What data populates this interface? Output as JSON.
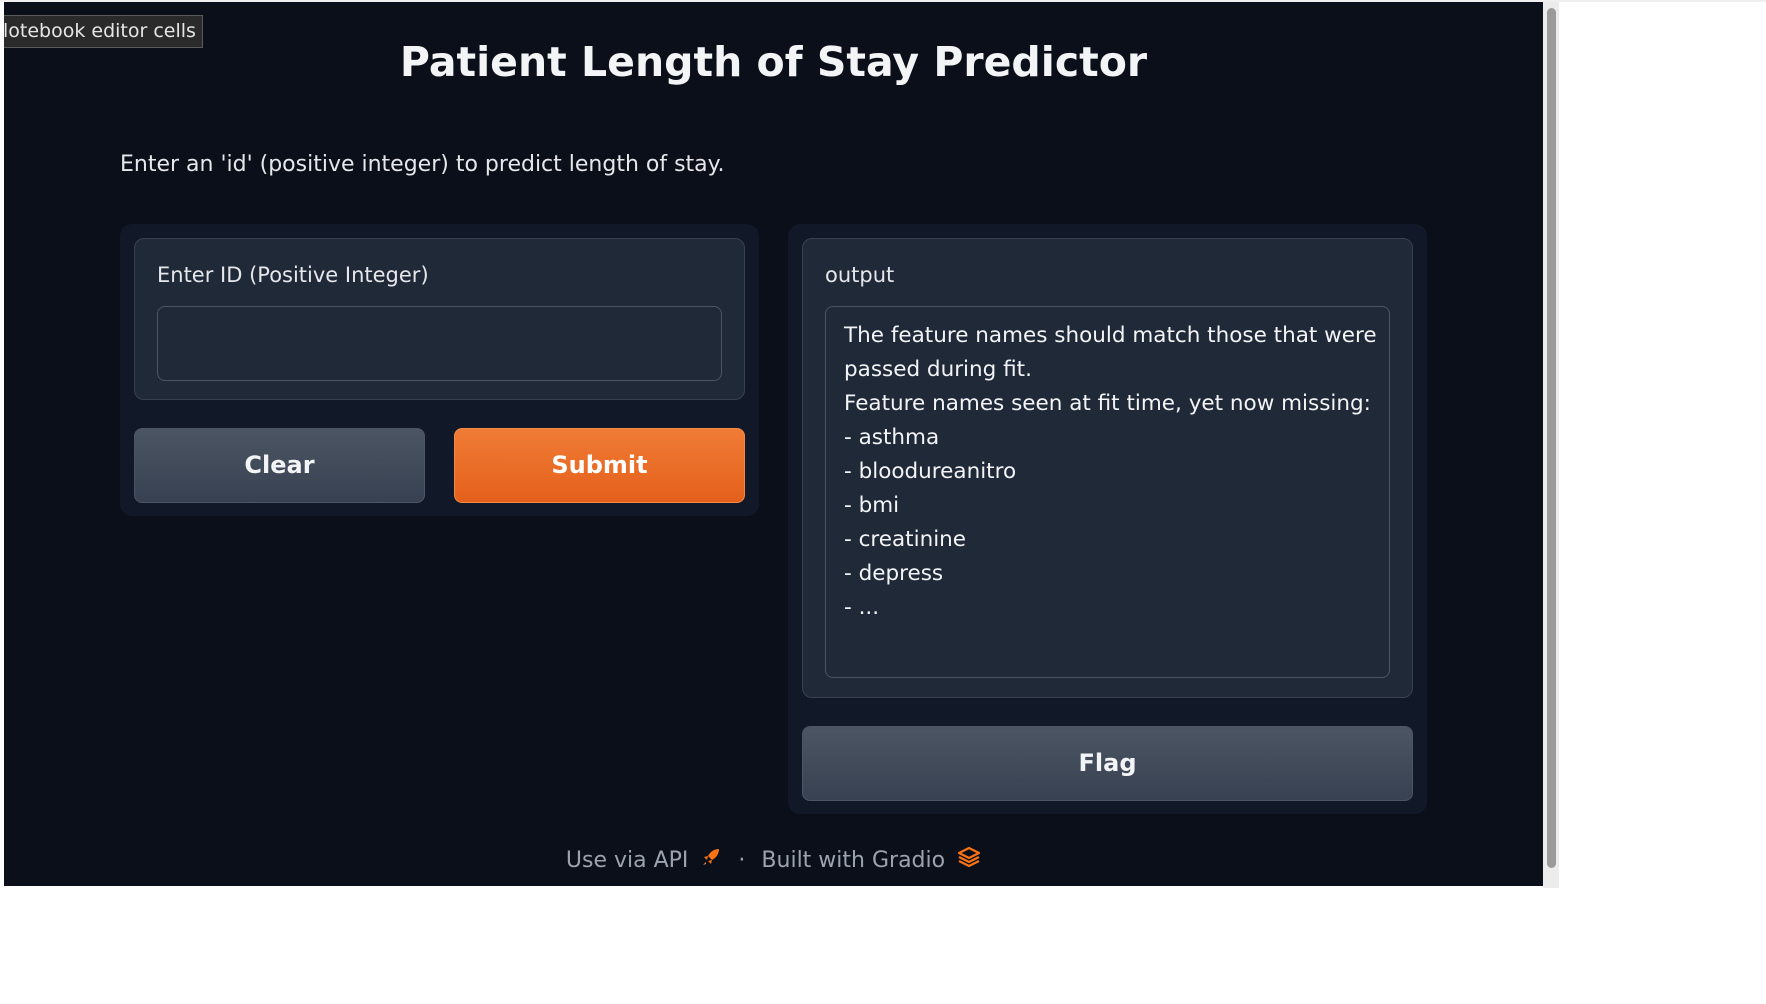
{
  "tooltip": {
    "text": "lotebook editor cells"
  },
  "app": {
    "title": "Patient Length of Stay Predictor",
    "description": "Enter an 'id' (positive integer) to predict length of stay."
  },
  "input_panel": {
    "field_label": "Enter ID (Positive Integer)",
    "field_value": "",
    "field_placeholder": "",
    "clear_label": "Clear",
    "submit_label": "Submit"
  },
  "output_panel": {
    "label": "output",
    "lines": [
      "The feature names should match those that were",
      "passed during fit.",
      "Feature names seen at fit time, yet now missing:",
      "- asthma",
      "- bloodureanitro",
      "- bmi",
      "- creatinine",
      "- depress",
      "- ..."
    ],
    "flag_label": "Flag"
  },
  "footer": {
    "api_label": "Use via API",
    "api_icon": "rocket-icon",
    "separator": "·",
    "built_label": "Built with Gradio",
    "gradio_icon": "gradio-logo-icon"
  },
  "colors": {
    "background": "#0b0f19",
    "panel": "#111827",
    "block": "#1f2937",
    "primary": "#e4601c",
    "secondary": "#4b5563"
  }
}
